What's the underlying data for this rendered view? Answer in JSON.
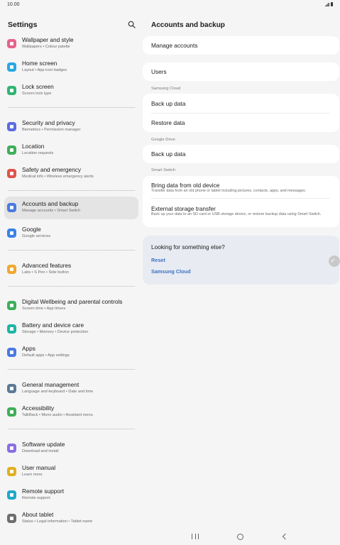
{
  "status_bar": {
    "time": "10.00"
  },
  "left_panel": {
    "title": "Settings",
    "items": [
      {
        "title": "Wallpaper and style",
        "subtitle": "Wallpapers  •  Colour palette",
        "icon": "wallpaper-icon",
        "color": "#e8618c"
      },
      {
        "title": "Home screen",
        "subtitle": "Layout  •  App icon badges",
        "icon": "home-screen-icon",
        "color": "#2aa8e0"
      },
      {
        "title": "Lock screen",
        "subtitle": "Screen lock type",
        "icon": "lock-icon",
        "color": "#2fb573"
      },
      {
        "title": "Security and privacy",
        "subtitle": "Biometrics  •  Permission manager",
        "icon": "shield-icon",
        "color": "#5a6ee0"
      },
      {
        "title": "Location",
        "subtitle": "Location requests",
        "icon": "location-pin-icon",
        "color": "#3fae5a"
      },
      {
        "title": "Safety and emergency",
        "subtitle": "Medical info  •  Wireless emergency alerts",
        "icon": "emergency-icon",
        "color": "#e0524a"
      },
      {
        "title": "Accounts and backup",
        "subtitle": "Manage accounts  •  Smart Switch",
        "icon": "sync-icon",
        "color": "#4a7ae0"
      },
      {
        "title": "Google",
        "subtitle": "Google services",
        "icon": "google-icon",
        "color": "#3b82e6"
      },
      {
        "title": "Advanced features",
        "subtitle": "Labs  •  S Pen  •  Side button",
        "icon": "advanced-features-icon",
        "color": "#f0a830"
      },
      {
        "title": "Digital Wellbeing and parental controls",
        "subtitle": "Screen time  •  App timers",
        "icon": "wellbeing-icon",
        "color": "#3fae5a"
      },
      {
        "title": "Battery and device care",
        "subtitle": "Storage  •  Memory  •  Device protection",
        "icon": "device-care-icon",
        "color": "#1fb5a5"
      },
      {
        "title": "Apps",
        "subtitle": "Default apps  •  App settings",
        "icon": "apps-grid-icon",
        "color": "#4a7ae0"
      },
      {
        "title": "General management",
        "subtitle": "Language and keyboard  •  Date and time",
        "icon": "sliders-icon",
        "color": "#5a7a96"
      },
      {
        "title": "Accessibility",
        "subtitle": "TalkBack  •  Mono audio  •  Assistant menu",
        "icon": "accessibility-icon",
        "color": "#3fae5a"
      },
      {
        "title": "Software update",
        "subtitle": "Download and install",
        "icon": "software-update-icon",
        "color": "#8a6ee0"
      },
      {
        "title": "User manual",
        "subtitle": "Learn more",
        "icon": "manual-icon",
        "color": "#e0b020"
      },
      {
        "title": "Remote support",
        "subtitle": "Remote support",
        "icon": "headset-icon",
        "color": "#1fa8c8"
      },
      {
        "title": "About tablet",
        "subtitle": "Status  •  Legal information  •  Tablet name",
        "icon": "info-icon",
        "color": "#6e6e6e"
      }
    ]
  },
  "right_panel": {
    "title": "Accounts and backup",
    "manage_accounts": "Manage accounts",
    "users": "Users",
    "samsung_cloud_label": "Samsung Cloud",
    "back_up_data": "Back up data",
    "restore_data": "Restore data",
    "google_drive_label": "Google Drive",
    "google_back_up_data": "Back up data",
    "smart_switch_label": "Smart Switch",
    "bring_data_title": "Bring data from old device",
    "bring_data_sub": "Transfer data from an old phone or tablet including pictures, contacts, apps, and messages.",
    "external_title": "External storage transfer",
    "external_sub": "Back up your data to an SD card or USB storage device, or restore backup data using Smart Switch.",
    "looking_title": "Looking for something else?",
    "link_reset": "Reset",
    "link_samsung_cloud": "Samsung Cloud"
  },
  "accent_color": "#3a73c4"
}
